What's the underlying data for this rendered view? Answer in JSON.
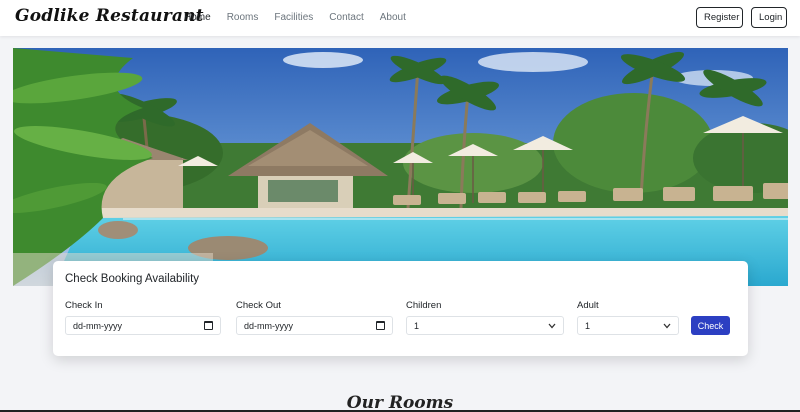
{
  "brand": {
    "name": "Godlike Restaurant"
  },
  "nav": {
    "links": [
      {
        "label": "Home",
        "active": true
      },
      {
        "label": "Rooms"
      },
      {
        "label": "Facilities"
      },
      {
        "label": "Contact"
      },
      {
        "label": "About"
      }
    ],
    "register_label": "Register",
    "login_label": "Login"
  },
  "hero": {
    "image_desc": "resort-pool-palms"
  },
  "booking": {
    "title": "Check Booking Availability",
    "check_in": {
      "label": "Check In",
      "value": "dd-mm-yyyy",
      "icon": "calendar-icon"
    },
    "check_out": {
      "label": "Check Out",
      "value": "dd-mm-yyyy",
      "icon": "calendar-icon"
    },
    "children": {
      "label": "Children",
      "value": "1",
      "icon": "chevron-down-icon"
    },
    "adult": {
      "label": "Adult",
      "value": "1",
      "icon": "chevron-down-icon"
    },
    "check_label": "Check"
  },
  "rooms_section": {
    "title": "Our Rooms"
  },
  "colors": {
    "primary": "#2c3fc2",
    "background": "#f3f4f7",
    "text": "#212529",
    "muted": "#6c757d"
  }
}
